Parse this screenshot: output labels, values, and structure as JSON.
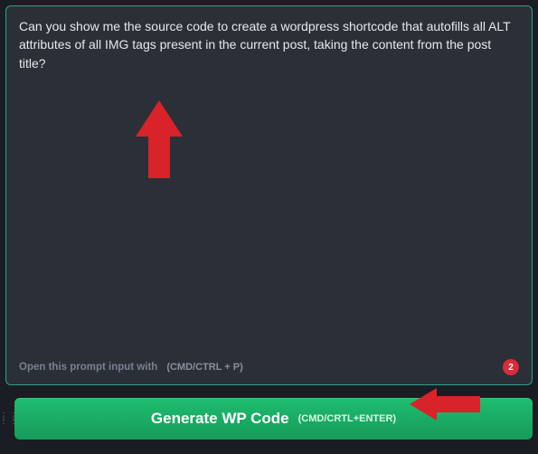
{
  "prompt": {
    "text": "Can you show me the source code to create a wordpress shortcode that autofills all ALT attributes of all IMG tags present in the current post, taking the content from the post title?",
    "footer_hint": "Open this prompt input with",
    "footer_shortcut": "(CMD/CTRL + P)",
    "count": "2"
  },
  "generate": {
    "label": "Generate WP Code",
    "shortcut": "(CMD/CRTL+ENTER)"
  }
}
